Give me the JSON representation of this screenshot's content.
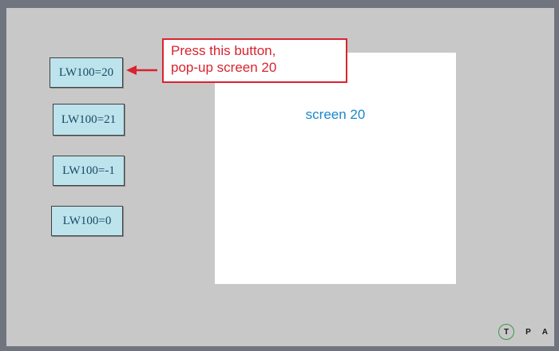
{
  "buttons": [
    {
      "label": "LW100=20"
    },
    {
      "label": "LW100=21"
    },
    {
      "label": "LW100=-1"
    },
    {
      "label": "LW100=0"
    }
  ],
  "popup": {
    "title": "screen 20"
  },
  "callout": {
    "line1": "Press this button,",
    "line2": "pop-up screen 20"
  },
  "status": {
    "t": "T",
    "p": "P",
    "a": "A"
  },
  "colors": {
    "frame": "#6f747f",
    "screen_bg": "#c8c8c8",
    "button_bg": "#bde3ec",
    "callout": "#d9232e",
    "popup_title": "#1b87c9"
  }
}
